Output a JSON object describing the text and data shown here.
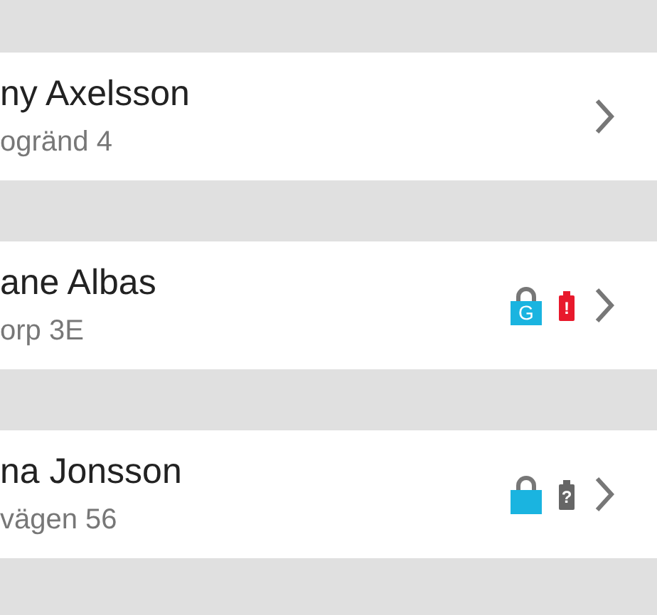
{
  "contacts": [
    {
      "name": "ny Axelsson",
      "address": "ogränd 4"
    },
    {
      "name": "ane Albas",
      "address": "orp 3E",
      "icons": [
        {
          "kind": "lock",
          "label": "G"
        },
        {
          "kind": "battery",
          "mark": "!",
          "color": "#e8192c"
        }
      ]
    },
    {
      "name": "na Jonsson",
      "address": "vägen 56",
      "icons": [
        {
          "kind": "lock"
        },
        {
          "kind": "battery",
          "mark": "?",
          "color": "#666666"
        }
      ]
    }
  ]
}
